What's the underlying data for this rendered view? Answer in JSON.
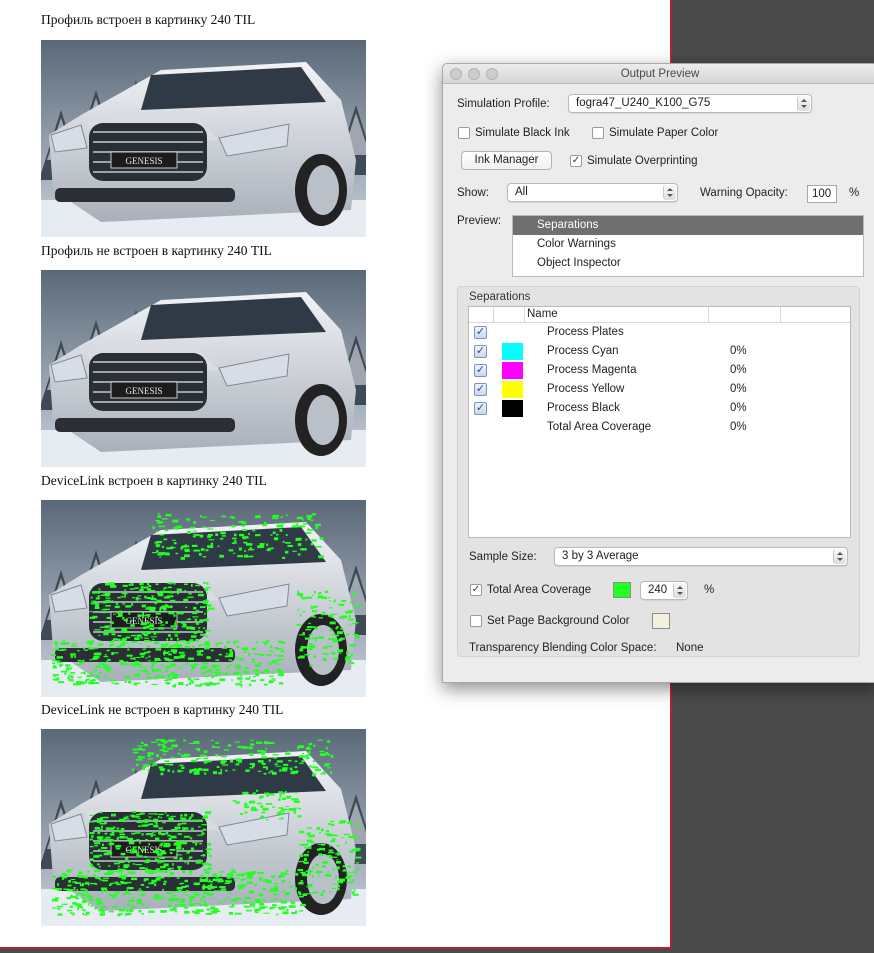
{
  "document": {
    "captions": [
      "Профиль встроен в картинку 240 TIL",
      "Профиль не встроен в картинку 240 TIL",
      "DeviceLink встроен в картинку 240 TIL",
      "DeviceLink не встроен в картинку 240 TIL"
    ],
    "badge_text": "GENESIS",
    "warning_color": "#22ff22"
  },
  "dialog": {
    "title": "Output Preview",
    "simulation_profile_label": "Simulation Profile:",
    "simulation_profile_value": "fogra47_U240_K100_G75",
    "simulate_black_ink": {
      "label": "Simulate Black Ink",
      "checked": false
    },
    "simulate_paper_color": {
      "label": "Simulate Paper Color",
      "checked": false
    },
    "ink_manager_label": "Ink Manager",
    "simulate_overprinting": {
      "label": "Simulate Overprinting",
      "checked": true
    },
    "show_label": "Show:",
    "show_value": "All",
    "warning_opacity_label": "Warning Opacity:",
    "warning_opacity_value": "100",
    "percent": "%",
    "preview_label": "Preview:",
    "preview_options": [
      "Separations",
      "Color Warnings",
      "Object Inspector"
    ],
    "preview_selected": "Separations",
    "separations_title": "Separations",
    "table_header_name": "Name",
    "separations": [
      {
        "name": "Process Plates",
        "checked": true,
        "color": null,
        "percent": ""
      },
      {
        "name": "Process Cyan",
        "checked": true,
        "color": "#00ffff",
        "percent": "0%"
      },
      {
        "name": "Process Magenta",
        "checked": true,
        "color": "#ff00ff",
        "percent": "0%"
      },
      {
        "name": "Process Yellow",
        "checked": true,
        "color": "#ffff00",
        "percent": "0%"
      },
      {
        "name": "Process Black",
        "checked": true,
        "color": "#000000",
        "percent": "0%"
      },
      {
        "name": "Total Area Coverage",
        "checked": false,
        "color": null,
        "percent": "0%"
      }
    ],
    "sample_size_label": "Sample Size:",
    "sample_size_value": "3 by 3 Average",
    "total_area_coverage": {
      "label": "Total Area Coverage",
      "checked": true,
      "color": "#22ff22",
      "value": "240"
    },
    "page_background": {
      "label": "Set Page Background Color",
      "checked": false,
      "color": "#f3f0de"
    },
    "transparency_label": "Transparency Blending Color Space:",
    "transparency_value": "None"
  }
}
